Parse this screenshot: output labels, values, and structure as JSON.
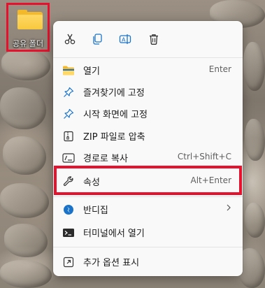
{
  "desktop": {
    "icon": {
      "label": "공유 폴더",
      "icon": "folder-icon"
    }
  },
  "context_menu": {
    "toolbar": [
      {
        "name": "cut",
        "icon": "scissors-icon"
      },
      {
        "name": "copy",
        "icon": "copy-icon"
      },
      {
        "name": "rename",
        "icon": "rename-icon"
      },
      {
        "name": "delete",
        "icon": "trash-icon"
      }
    ],
    "items": [
      {
        "label": "열기",
        "shortcut": "Enter",
        "icon": "folder-open-icon"
      },
      {
        "label": "즐겨찾기에 고정",
        "shortcut": "",
        "icon": "pin-icon"
      },
      {
        "label": "시작 화면에 고정",
        "shortcut": "",
        "icon": "pin-icon"
      },
      {
        "label": "ZIP 파일로 압축",
        "shortcut": "",
        "icon": "zip-icon"
      },
      {
        "label": "경로로 복사",
        "shortcut": "Ctrl+Shift+C",
        "icon": "path-copy-icon"
      },
      {
        "label": "속성",
        "shortcut": "Alt+Enter",
        "icon": "wrench-icon"
      },
      {
        "label": "반디집",
        "shortcut": "",
        "icon": "bandizip-icon",
        "submenu": true
      },
      {
        "label": "터미널에서 열기",
        "shortcut": "",
        "icon": "terminal-icon"
      },
      {
        "label": "추가 옵션 표시",
        "shortcut": "",
        "icon": "more-options-icon"
      }
    ]
  },
  "colors": {
    "highlight_border": "#e8112d",
    "menu_background": "#f9f9f9",
    "folder_yellow": "#f8c93e",
    "accent_blue": "#1a73c9"
  }
}
